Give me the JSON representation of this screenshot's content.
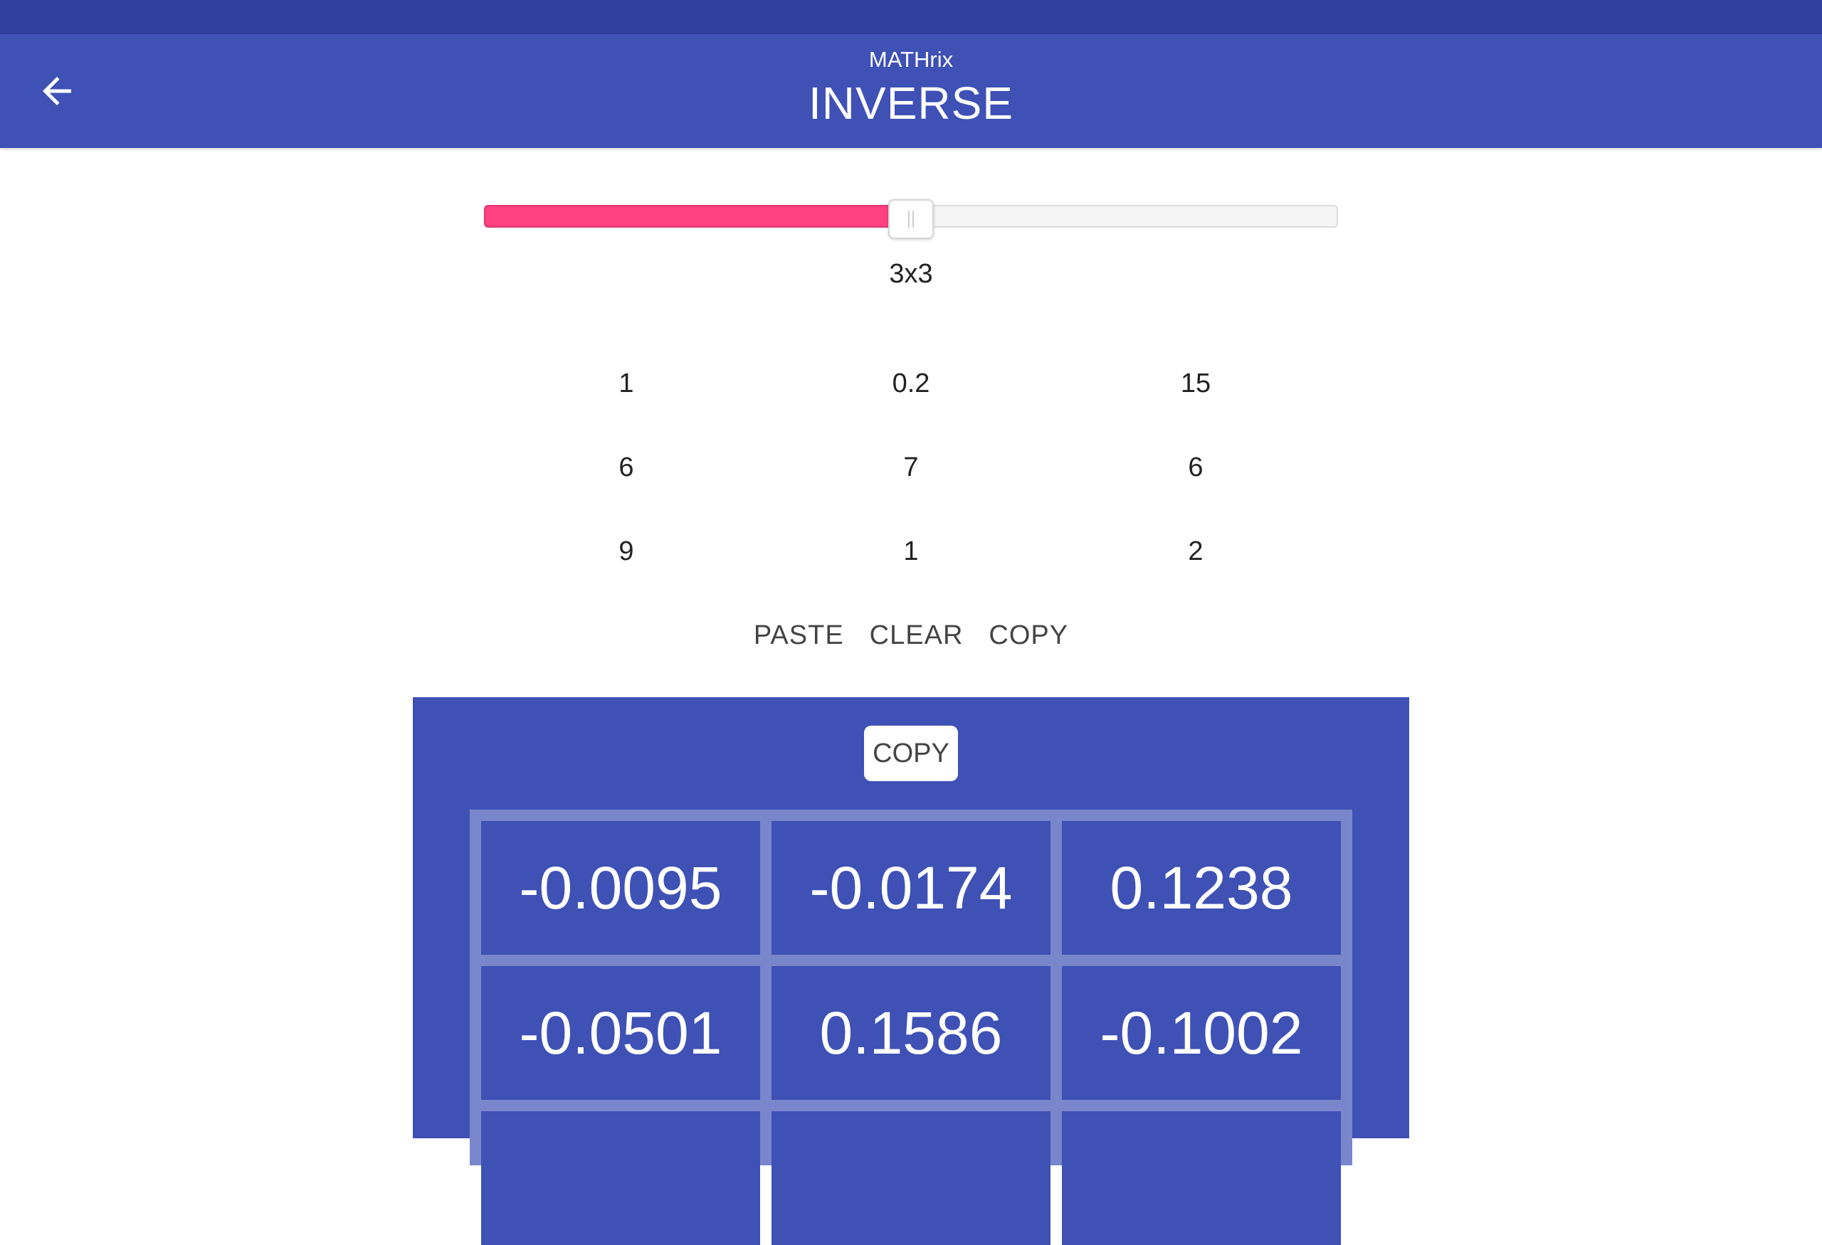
{
  "app_bar": {
    "app_name": "MATHrix",
    "title": "INVERSE",
    "back_icon": "arrow-left-icon"
  },
  "colors": {
    "status_bar": "#303f9f",
    "primary": "#3f51b5",
    "accent": "#ff4081",
    "grid_border": "#7986cb"
  },
  "size_slider": {
    "label": "3x3",
    "value_fraction": 0.5
  },
  "input_matrix": [
    [
      "1",
      "0.2",
      "15"
    ],
    [
      "6",
      "7",
      "6"
    ],
    [
      "9",
      "1",
      "2"
    ]
  ],
  "actions": {
    "paste": "PASTE",
    "clear": "CLEAR",
    "copy": "COPY"
  },
  "result": {
    "copy_label": "COPY",
    "matrix": [
      [
        "-0.0095",
        "-0.0174",
        "0.1238"
      ],
      [
        "-0.0501",
        "0.1586",
        "-0.1002"
      ],
      [
        "",
        "",
        ""
      ]
    ]
  }
}
